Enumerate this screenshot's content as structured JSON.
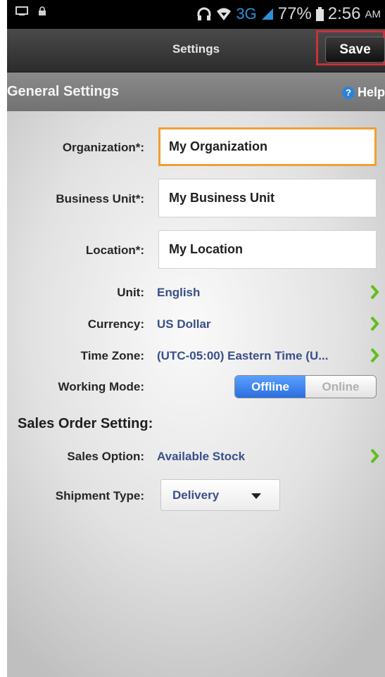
{
  "status_bar": {
    "battery": "77%",
    "network": "3G",
    "time": "2:56",
    "ampm": "AM"
  },
  "header": {
    "title": "Settings",
    "save_label": "Save"
  },
  "section": {
    "title": "General Settings",
    "help_label": "Help",
    "help_icon_text": "?"
  },
  "fields": {
    "organization": {
      "label": "Organization*:",
      "value": "My Organization"
    },
    "business_unit": {
      "label": "Business Unit*:",
      "value": "My Business Unit"
    },
    "location": {
      "label": "Location*:",
      "value": "My Location"
    }
  },
  "rows": {
    "unit": {
      "label": "Unit:",
      "value": "English"
    },
    "currency": {
      "label": "Currency:",
      "value": "US Dollar"
    },
    "timezone": {
      "label": "Time Zone:",
      "value": "(UTC-05:00) Eastern Time (U..."
    }
  },
  "working_mode": {
    "label": "Working Mode:",
    "offline": "Offline",
    "online": "Online",
    "selected": "Offline"
  },
  "sales": {
    "title": "Sales Order Setting:",
    "option_label": "Sales Option:",
    "option_value": "Available Stock",
    "shipment_label": "Shipment Type:",
    "shipment_value": "Delivery"
  },
  "colors": {
    "accent_link": "#3a4f8a",
    "chevron": "#5fbf1a",
    "focus_border": "#f0a030",
    "highlight_frame": "#c8323c",
    "toggle_on": "#2a6fe0"
  }
}
